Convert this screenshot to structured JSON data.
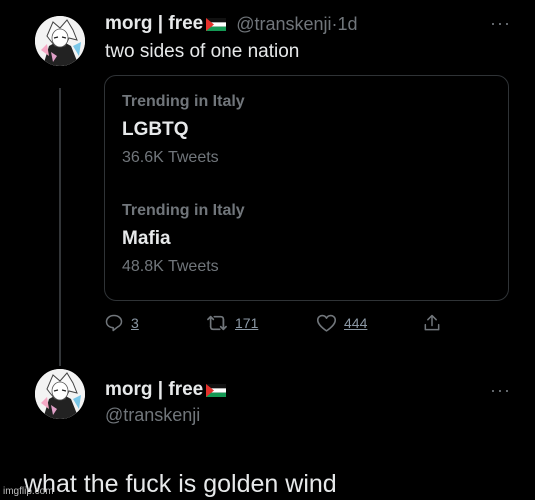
{
  "tweet": {
    "display_name": "morg | free",
    "handle": "@transkenji",
    "separator": " · ",
    "timestamp": "1d",
    "text": "two sides of one nation",
    "trends": [
      {
        "context": "Trending in Italy",
        "name": "LGBTQ",
        "count": "36.6K Tweets"
      },
      {
        "context": "Trending in Italy",
        "name": "Mafia",
        "count": "48.8K Tweets"
      }
    ],
    "actions": {
      "replies": "3",
      "retweets": "171",
      "likes": "444"
    }
  },
  "reply": {
    "display_name": "morg | free",
    "handle": "@transkenji",
    "text": "what the fuck is golden wind"
  },
  "watermark": "imgflip.com",
  "colors": {
    "background": "#000000",
    "primary_text": "#e7e9ea",
    "secondary_text": "#71767b",
    "border": "#2f3336"
  },
  "icons": {
    "more": "more-horizontal-icon",
    "reply": "reply-icon",
    "retweet": "retweet-icon",
    "like": "heart-icon",
    "share": "share-icon",
    "flag": "palestine-flag-icon"
  }
}
